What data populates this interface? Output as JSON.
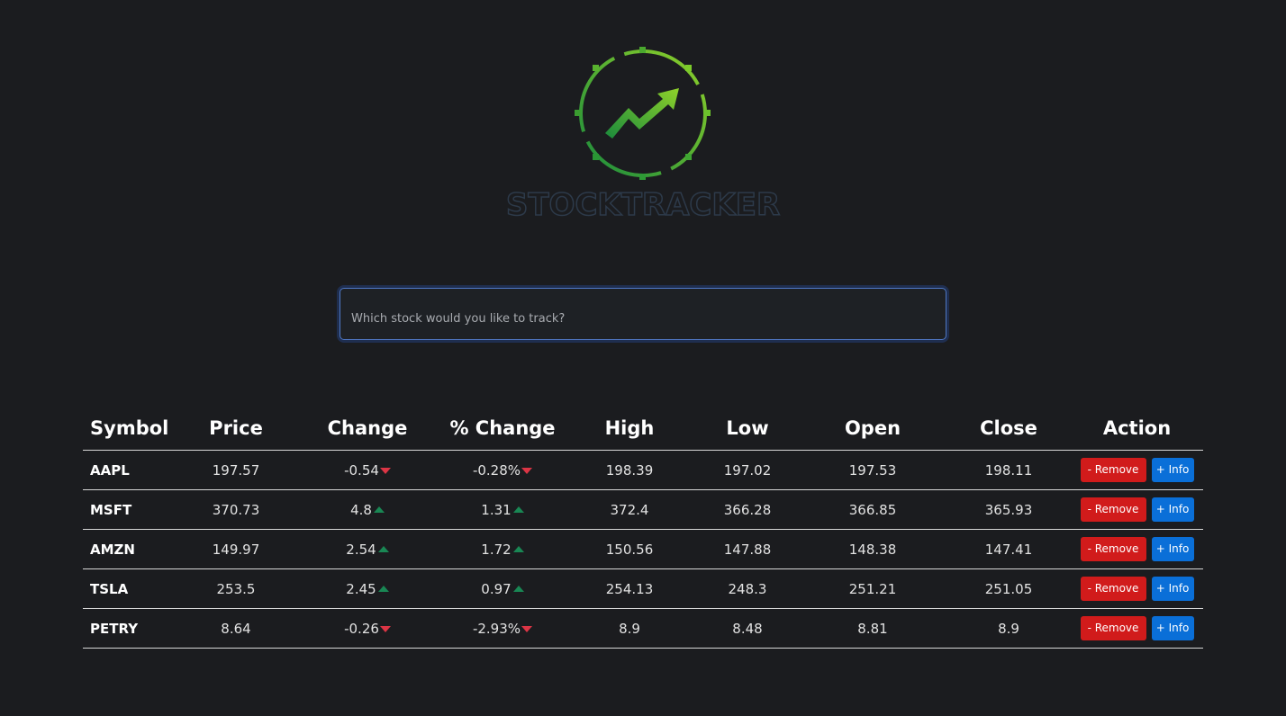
{
  "logo": {
    "text": "STOCKTRACKER",
    "icon": "trending-up-arrow-icon"
  },
  "search": {
    "placeholder": "Which stock would you like to track?"
  },
  "table": {
    "headers": [
      "Symbol",
      "Price",
      "Change",
      "% Change",
      "High",
      "Low",
      "Open",
      "Close",
      "Action"
    ],
    "rows": [
      {
        "symbol": "AAPL",
        "price": "197.57",
        "change": "-0.54",
        "pct_change": "-0.28%",
        "direction": "down",
        "high": "198.39",
        "low": "197.02",
        "open": "197.53",
        "close": "198.11"
      },
      {
        "symbol": "MSFT",
        "price": "370.73",
        "change": "4.8",
        "pct_change": "1.31",
        "direction": "up",
        "high": "372.4",
        "low": "366.28",
        "open": "366.85",
        "close": "365.93"
      },
      {
        "symbol": "AMZN",
        "price": "149.97",
        "change": "2.54",
        "pct_change": "1.72",
        "direction": "up",
        "high": "150.56",
        "low": "147.88",
        "open": "148.38",
        "close": "147.41"
      },
      {
        "symbol": "TSLA",
        "price": "253.5",
        "change": "2.45",
        "pct_change": "0.97",
        "direction": "up",
        "high": "254.13",
        "low": "248.3",
        "open": "251.21",
        "close": "251.05"
      },
      {
        "symbol": "PETRY",
        "price": "8.64",
        "change": "-0.26",
        "pct_change": "-2.93%",
        "direction": "down",
        "high": "8.9",
        "low": "8.48",
        "open": "8.81",
        "close": "8.9"
      }
    ],
    "remove_label": "- Remove",
    "info_label": "+ Info"
  },
  "colors": {
    "background": "#1b1c1f",
    "negative": "#dc3545",
    "positive": "#198754",
    "remove_button": "#d11b1b",
    "info_button": "#0a6fd8",
    "logo_green": "#5cb531"
  }
}
